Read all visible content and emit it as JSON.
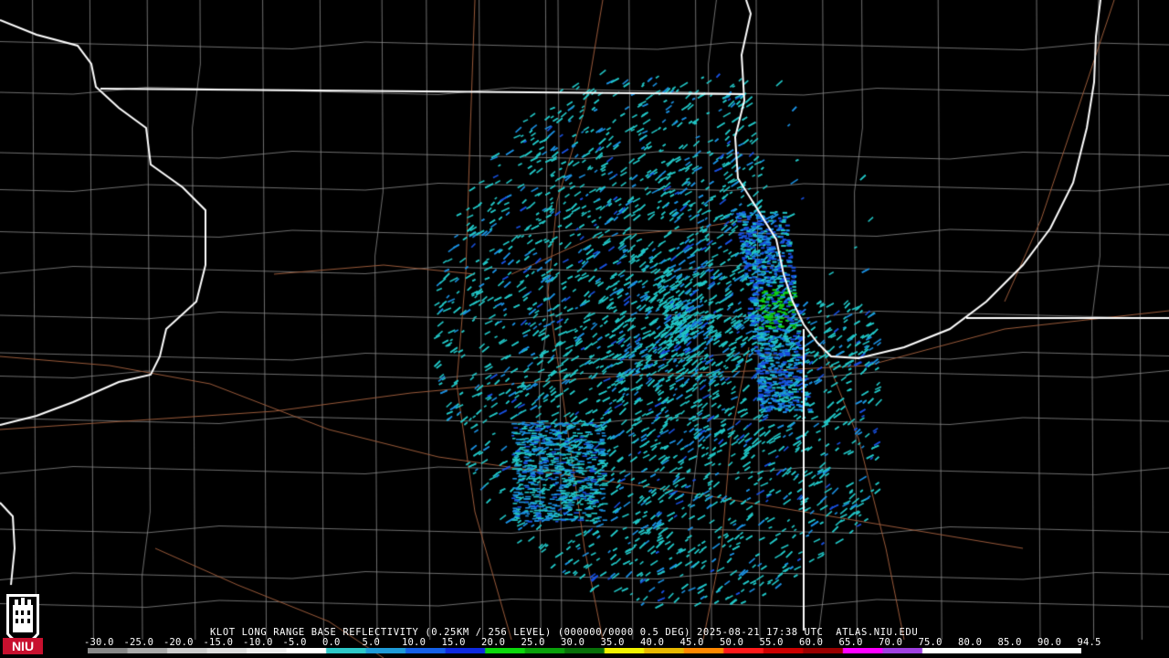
{
  "caption": {
    "station": "KLOT",
    "product": "LONG RANGE BASE REFLECTIVITY",
    "resolution": "(0.25KM / 256 LEVEL)",
    "volume": "(000000/0000",
    "tilt": "0.5 DEG)",
    "datetime": "2025-08-21 17:38 UTC",
    "source": "ATLAS.NIU.EDU"
  },
  "logo": {
    "text": "NIU",
    "icon": "niu-logo-icon"
  },
  "colorscale": {
    "ticks": [
      "-30.0",
      "-25.0",
      "-20.0",
      "-15.0",
      "-10.0",
      "-5.0",
      "0.0",
      "5.0",
      "10.0",
      "15.0",
      "20.0",
      "25.0",
      "30.0",
      "35.0",
      "40.0",
      "45.0",
      "50.0",
      "55.0",
      "60.0",
      "65.0",
      "70.0",
      "75.0",
      "80.0",
      "85.0",
      "90.0",
      "94.5"
    ],
    "colors": [
      "#888888",
      "#aaaaaa",
      "#cccccc",
      "#dddddd",
      "#eeeeee",
      "#ffffff",
      "#2ec8c8",
      "#1f9bd8",
      "#1560e8",
      "#0e2ae0",
      "#0cd80c",
      "#0aa00a",
      "#087008",
      "#f2f200",
      "#e8b800",
      "#ff8800",
      "#ff1a1a",
      "#cc0000",
      "#990000",
      "#ff00ff",
      "#a040e0",
      "#ffffff",
      "#ffffff",
      "#ffffff",
      "#ffffff"
    ]
  },
  "map": {
    "background": "#000000",
    "state_border_color": "#ffffff",
    "county_color": "#8a8a8a",
    "highway_color": "#9a5a3a",
    "echo_colors": [
      "#21c6c6",
      "#1a8fe0",
      "#1850e0",
      "#10d010"
    ]
  }
}
